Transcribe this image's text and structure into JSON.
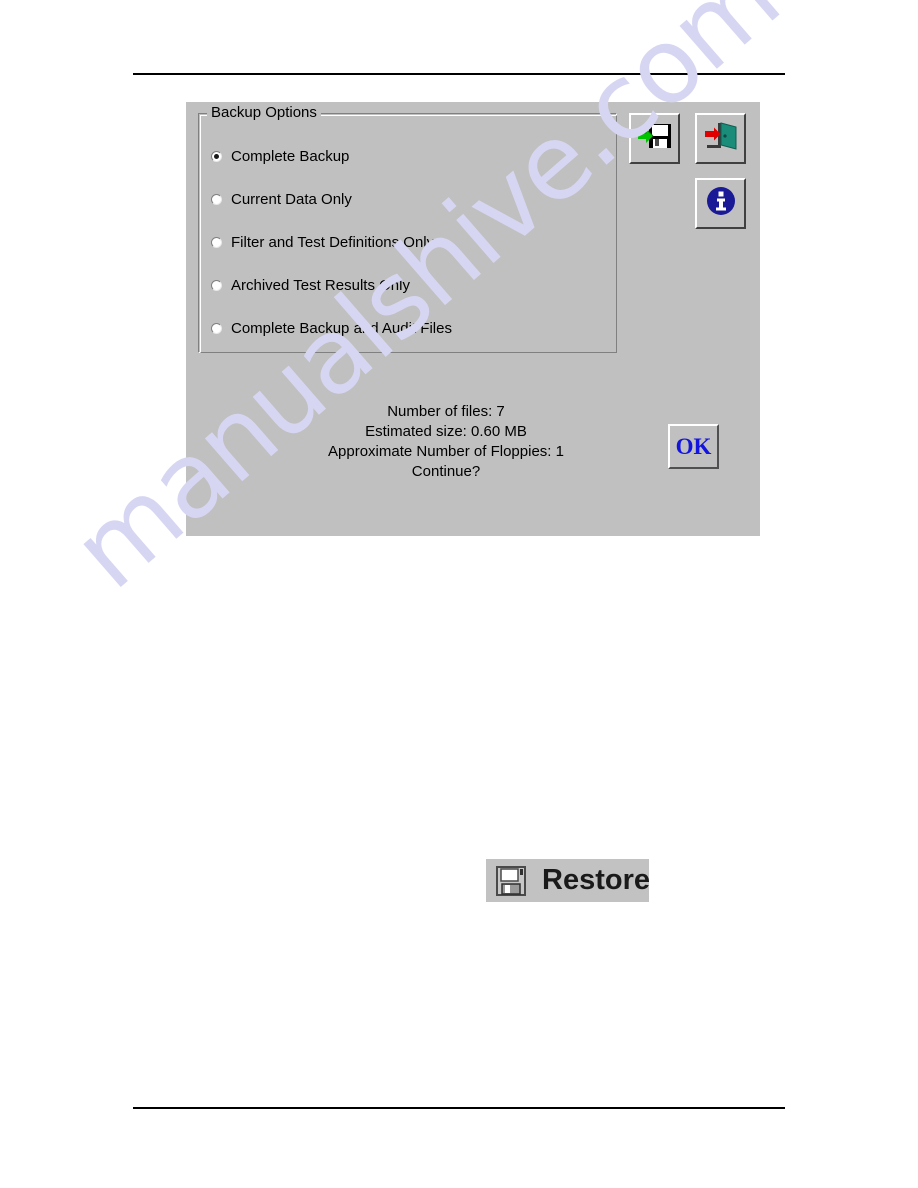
{
  "page": {
    "background": "#ffffff",
    "rule_color": "#000000"
  },
  "watermark": {
    "text": "manualshive.com",
    "color": "#d6d6f2"
  },
  "dialog": {
    "background": "#c0c0c0",
    "groupbox": {
      "title": "Backup Options",
      "options": [
        {
          "label": "Complete Backup",
          "selected": true
        },
        {
          "label": "Current Data Only",
          "selected": false
        },
        {
          "label": "Filter and Test Definitions Only",
          "selected": false
        },
        {
          "label": "Archived Test Results Only",
          "selected": false
        },
        {
          "label": "Complete Backup and Audit Files",
          "selected": false
        }
      ]
    },
    "toolbar": {
      "backup_button": {
        "icon": "floppy-disk-save-icon",
        "arrow_color": "#00c000"
      },
      "exit_button": {
        "icon": "exit-door-icon",
        "arrow_color": "#e00000",
        "door_color": "#1a8c7a"
      },
      "info_button": {
        "icon": "info-circle-icon",
        "color": "#1a1a96"
      }
    },
    "status": {
      "line1": "Number of files: 7",
      "line2": "Estimated size: 0.60 MB",
      "line3": "Approximate Number of Floppies: 1",
      "line4": "Continue?"
    },
    "ok_button": {
      "label": "OK",
      "color": "#1414e0"
    }
  },
  "restore": {
    "icon": "floppy-disk-icon",
    "label": "Restore",
    "background": "#c2c2c2"
  }
}
